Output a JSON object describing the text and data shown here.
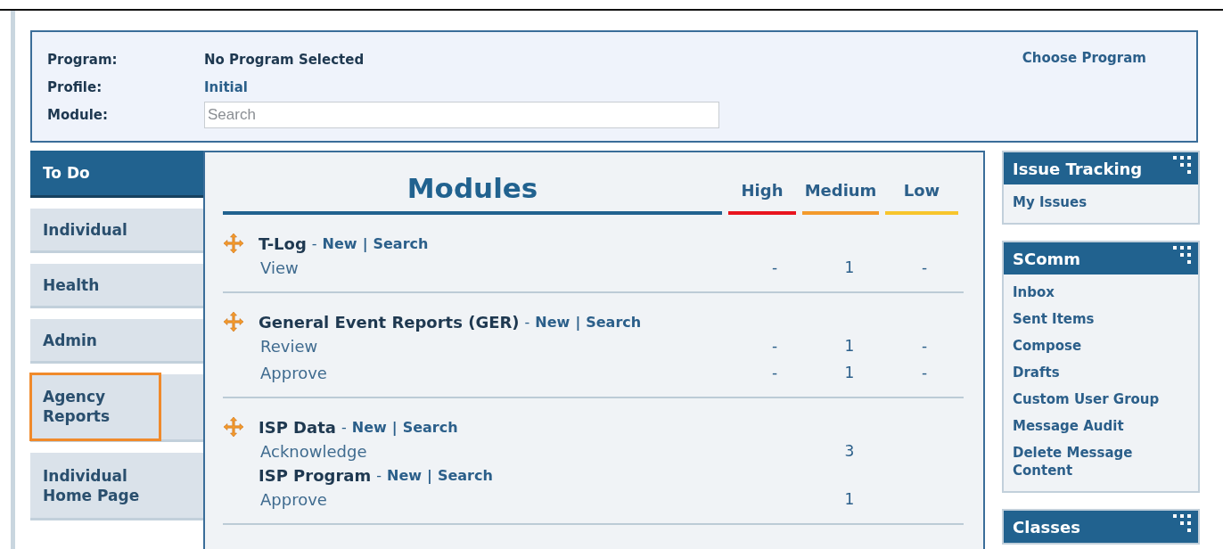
{
  "header": {
    "fields": [
      {
        "label": "Program:",
        "kind": "text",
        "value": "No Program Selected"
      },
      {
        "label": "Profile:",
        "kind": "text",
        "value": "Initial"
      },
      {
        "label": "Module:",
        "kind": "search",
        "placeholder": "Search"
      }
    ],
    "action": "Choose Program"
  },
  "nav": [
    {
      "label": "To Do",
      "selected": true,
      "outlined": false
    },
    {
      "label": "Individual",
      "selected": false,
      "outlined": false
    },
    {
      "label": "Health",
      "selected": false,
      "outlined": false
    },
    {
      "label": "Admin",
      "selected": false,
      "outlined": false
    },
    {
      "label": "Agency Reports",
      "selected": false,
      "outlined": true
    },
    {
      "label": "Individual Home Page",
      "selected": false,
      "outlined": false
    }
  ],
  "modules": {
    "title": "Modules",
    "columns": [
      {
        "label": "High",
        "color": "#e8141e"
      },
      {
        "label": "Medium",
        "color": "#f39a2c"
      },
      {
        "label": "Low",
        "color": "#f7c52d"
      }
    ],
    "sections": [
      {
        "entries": [
          {
            "kind": "heading",
            "title": "T-Log",
            "dash": "-",
            "links": [
              "New",
              "Search"
            ],
            "pipes": [
              "|"
            ]
          },
          {
            "kind": "row",
            "label": "View",
            "values": {
              "high": "-",
              "medium": "1",
              "low": "-"
            }
          }
        ]
      },
      {
        "entries": [
          {
            "kind": "heading",
            "title": "General Event Reports (GER)",
            "dash": "-",
            "links": [
              "New",
              "Search"
            ],
            "pipes": [
              "|"
            ]
          },
          {
            "kind": "row",
            "label": "Review",
            "values": {
              "high": "-",
              "medium": "1",
              "low": "-"
            }
          },
          {
            "kind": "row",
            "label": "Approve",
            "values": {
              "high": "-",
              "medium": "1",
              "low": "-"
            }
          }
        ]
      },
      {
        "entries": [
          {
            "kind": "heading",
            "title": "ISP Data",
            "dash": "-",
            "links": [
              "New",
              "Search"
            ],
            "pipes": [
              "|"
            ]
          },
          {
            "kind": "row",
            "label": "Acknowledge",
            "values": {
              "medium": "3"
            }
          },
          {
            "kind": "subheading",
            "title": "ISP Program",
            "dash": "-",
            "links": [
              "New",
              "Search"
            ],
            "pipes": [
              "|"
            ]
          },
          {
            "kind": "row",
            "label": "Approve",
            "values": {
              "medium": "1"
            }
          }
        ]
      }
    ]
  },
  "panels": [
    {
      "title": "Issue Tracking",
      "items": [
        "My Issues"
      ]
    },
    {
      "title": "SComm",
      "items": [
        "Inbox",
        "Sent Items",
        "Compose",
        "Drafts",
        "Custom User Group",
        "Message Audit",
        "Delete Message Content"
      ]
    },
    {
      "title": "Classes"
    }
  ]
}
